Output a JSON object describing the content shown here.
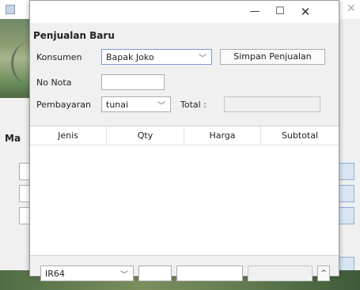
{
  "background": {
    "partial_label": "Ma"
  },
  "dialog": {
    "title": "Penjualan Baru",
    "window_controls": {
      "minimize": "—",
      "maximize": "☐",
      "close": "✕"
    },
    "konsumen": {
      "label": "Konsumen",
      "value": "Bapak Joko"
    },
    "save_button": "Simpan Penjualan",
    "no_nota": {
      "label": "No Nota",
      "value": ""
    },
    "pembayaran": {
      "label": "Pembayaran",
      "value": "tunai"
    },
    "total": {
      "label": "Total :",
      "value": ""
    },
    "table": {
      "columns": [
        "Jenis",
        "Qty",
        "Harga",
        "Subtotal"
      ],
      "rows": []
    },
    "bottom": {
      "jenis_value": "IR64",
      "qty_value": "",
      "harga_value": "",
      "subtotal_value": "",
      "up_button": "^"
    }
  }
}
